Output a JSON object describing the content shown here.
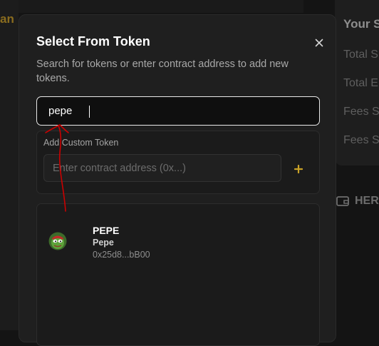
{
  "background": {
    "left_text": "an",
    "right_title": "Your S",
    "stats": [
      "Total S",
      "Total E",
      "Fees S",
      "Fees S"
    ],
    "hero_label": "HER"
  },
  "modal": {
    "title": "Select From Token",
    "description": "Search for tokens or enter contract address to add new tokens.",
    "close_icon": "close-icon"
  },
  "search": {
    "value": "pepe"
  },
  "custom_token": {
    "label": "Add Custom Token",
    "placeholder": "Enter contract address (0x...)",
    "add_icon": "plus-icon"
  },
  "results": [
    {
      "symbol": "PEPE",
      "name": "Pepe",
      "address": "0x25d8...bB00",
      "icon": "pepe-logo"
    }
  ],
  "colors": {
    "accent": "#c9a227",
    "annotation": "#cc0000",
    "modal_bg": "#1f1f1f"
  }
}
